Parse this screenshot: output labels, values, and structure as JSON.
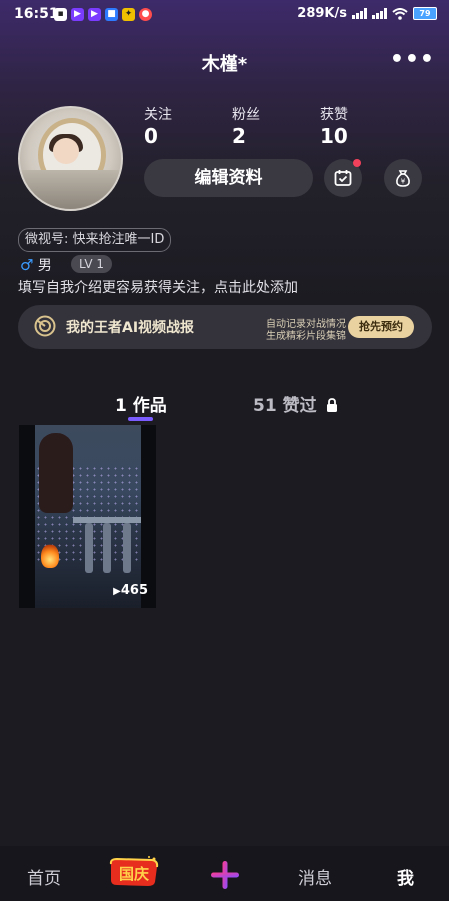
{
  "status": {
    "time": "16:51",
    "net_speed": "289K/s",
    "battery": "79"
  },
  "header": {
    "title": "木槿*",
    "more_icon": "more-dots-icon"
  },
  "profile": {
    "stats": [
      {
        "label": "关注",
        "value": "0"
      },
      {
        "label": "粉丝",
        "value": "2"
      },
      {
        "label": "获赞",
        "value": "10"
      }
    ],
    "edit_label": "编辑资料",
    "weishi_id": "微视号: 快来抢注唯一ID",
    "gender_symbol": "♂",
    "gender": "男",
    "level": "LV 1",
    "bio_placeholder": "填写自我介绍更容易获得关注，点击此处添加"
  },
  "banner": {
    "title": "我的王者AI视频战报",
    "line1": "自动记录对战情况",
    "line2": "生成精彩片段集锦",
    "button": "抢先预约"
  },
  "tabs": [
    {
      "label": "1 作品"
    },
    {
      "label": "51 赞过"
    }
  ],
  "videos": [
    {
      "plays": "465"
    }
  ],
  "nav": {
    "home": "首页",
    "festival": "国庆",
    "messages": "消息",
    "me": "我"
  },
  "colors": {
    "accent": "#7b5cff",
    "banner_button": "#e9d2a0",
    "notify_dot": "#f2415b",
    "plus_gradient": [
      "#ff3c8e",
      "#8a4dff"
    ]
  }
}
